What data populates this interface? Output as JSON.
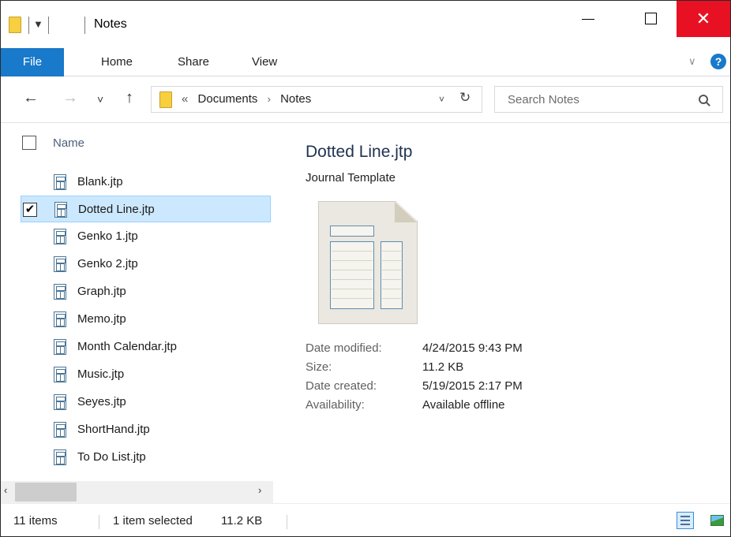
{
  "window": {
    "title": "Notes",
    "qat_arrow": "▼",
    "minimize_label": "",
    "close_label": "✕"
  },
  "ribbon": {
    "file_tab": "File",
    "tabs": [
      "Home",
      "Share",
      "View"
    ],
    "help": "?",
    "expand_chevron": "∨"
  },
  "address": {
    "back": "←",
    "forward": "→",
    "recent": "˅",
    "up": "↑",
    "overflow": "«",
    "crumbs": [
      "Documents",
      "Notes"
    ],
    "crumb_sep": "›",
    "dropdown": "˅",
    "refresh": "↻"
  },
  "search": {
    "placeholder": "Search Notes"
  },
  "list": {
    "column_name": "Name",
    "selected_check": "✔",
    "items": [
      "Blank.jtp",
      "Dotted Line.jtp",
      "Genko 1.jtp",
      "Genko 2.jtp",
      "Graph.jtp",
      "Memo.jtp",
      "Month Calendar.jtp",
      "Music.jtp",
      "Seyes.jtp",
      "ShortHand.jtp",
      "To Do List.jtp"
    ],
    "selected_index": 1
  },
  "scrollbar": {
    "left": "‹",
    "right": "›"
  },
  "preview": {
    "name": "Dotted Line.jtp",
    "type": "Journal Template",
    "details": [
      {
        "label": "Date modified:",
        "value": "4/24/2015 9:43 PM"
      },
      {
        "label": "Size:",
        "value": "11.2 KB"
      },
      {
        "label": "Date created:",
        "value": "5/19/2015 2:17 PM"
      },
      {
        "label": "Availability:",
        "value": "Available offline"
      }
    ]
  },
  "status": {
    "items_count": "11 items",
    "selection": "1 item selected",
    "size": "11.2 KB"
  },
  "icons": {
    "folder": "folder-icon",
    "file": "journal-template-file-icon",
    "search": "search-icon",
    "help": "help-icon"
  },
  "colors": {
    "accent": "#1979ca",
    "close_red": "#e81123",
    "selection": "#cce8ff",
    "folder": "#f7cf3f"
  }
}
